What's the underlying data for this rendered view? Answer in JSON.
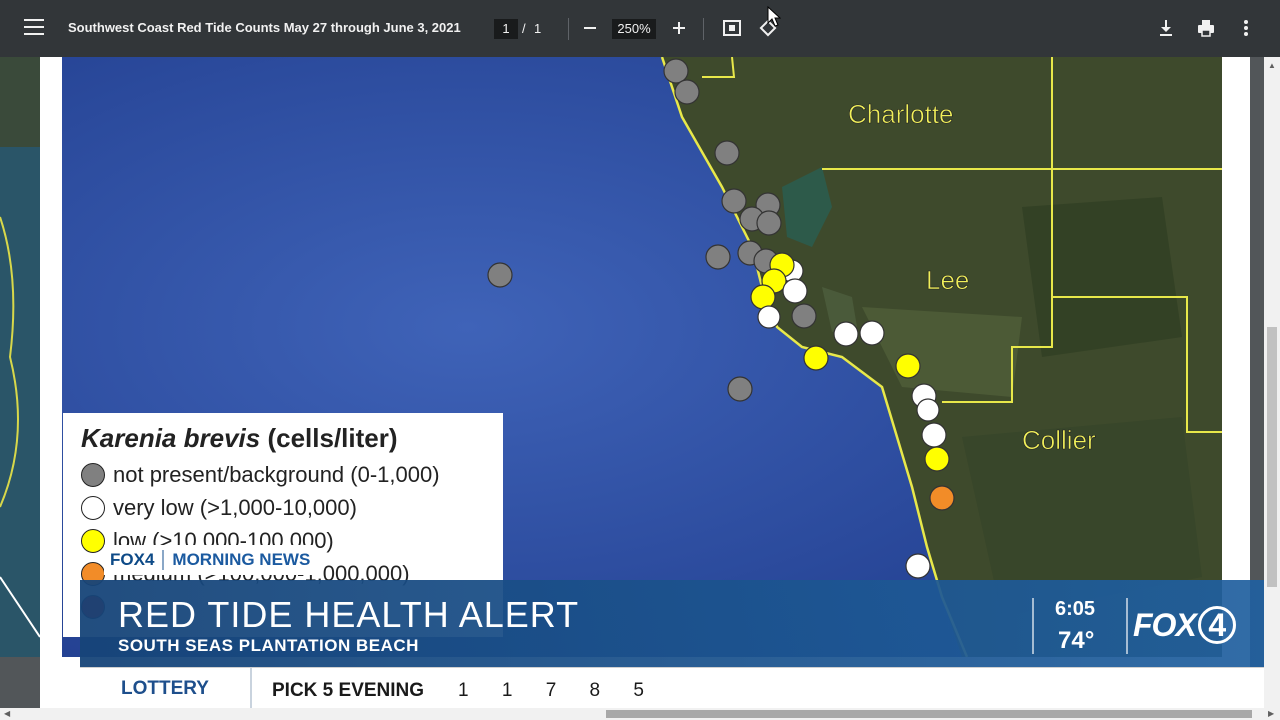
{
  "toolbar": {
    "title": "Southwest Coast Red Tide Counts May 27 through June 3, 2021",
    "current_page": "1",
    "page_separator": "/",
    "total_pages": "1",
    "zoom": "250%"
  },
  "map": {
    "labels": [
      "Charlotte",
      "Lee",
      "Collier"
    ]
  },
  "legend": {
    "species": "Karenia brevis",
    "unit": "(cells/liter)",
    "items": [
      {
        "label": "not present/background (0-1,000)",
        "color": "#808080"
      },
      {
        "label": "very low (>1,000-10,000)",
        "color": "#ffffff"
      },
      {
        "label": "low (>10,000-100,000)",
        "color": "#ffff00"
      },
      {
        "label": "medium (>100,000-1,000,000)",
        "color": "#f28c28"
      },
      {
        "label": "",
        "color": "#d40000"
      }
    ]
  },
  "station": {
    "brand": "FOX4",
    "program": "MORNING NEWS",
    "logo": "FOX4"
  },
  "banner": {
    "headline": "RED TIDE HEALTH ALERT",
    "subheadline": "SOUTH SEAS PLANTATION BEACH",
    "time": "6:05",
    "temperature": "74°"
  },
  "ticker": {
    "label": "LOTTERY",
    "game": "PICK 5 EVENING",
    "numbers": "1 1 7 8 5"
  },
  "colors": {
    "toolbar_bg": "#323639",
    "water": "#2f4fa8",
    "land": "#3e4a2c",
    "boundary": "#e8e84a",
    "banner": "#1b548f"
  }
}
